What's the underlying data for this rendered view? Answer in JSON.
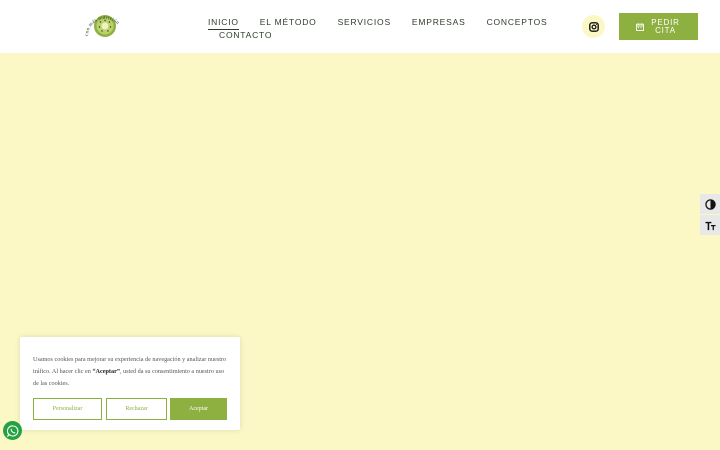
{
  "brand": {
    "logo_text": "con más nutrición"
  },
  "nav": {
    "items": [
      {
        "label": "INICIO",
        "active": true
      },
      {
        "label": "EL MÉTODO"
      },
      {
        "label": "SERVICIOS"
      },
      {
        "label": "EMPRESAS"
      },
      {
        "label": "CONCEPTOS"
      },
      {
        "label": "CONTACTO"
      }
    ]
  },
  "header": {
    "social_icon": "instagram-icon",
    "cta": {
      "label": "PEDIR CITA",
      "icon": "calendar-icon"
    }
  },
  "accessibility": {
    "contrast_icon": "contrast-toggle-icon",
    "text_size_icon": "text-size-icon"
  },
  "cookie_banner": {
    "text_before": "Usamos cookies para mejorar su experiencia de navegación y analizar nuestro tráfico. Al hacer clic en ",
    "text_bold": "“Aceptar”",
    "text_after": ", usted da su consentimiento a nuestro uso de las cookies.",
    "buttons": {
      "customize": "Personalizar",
      "reject": "Rechazar",
      "accept": "Aceptar"
    }
  },
  "floating": {
    "whatsapp_icon": "whatsapp-icon"
  },
  "colors": {
    "accent_green": "#8db041",
    "background_yellow": "#fbf8c6",
    "nav_text": "#2d3e2a"
  }
}
